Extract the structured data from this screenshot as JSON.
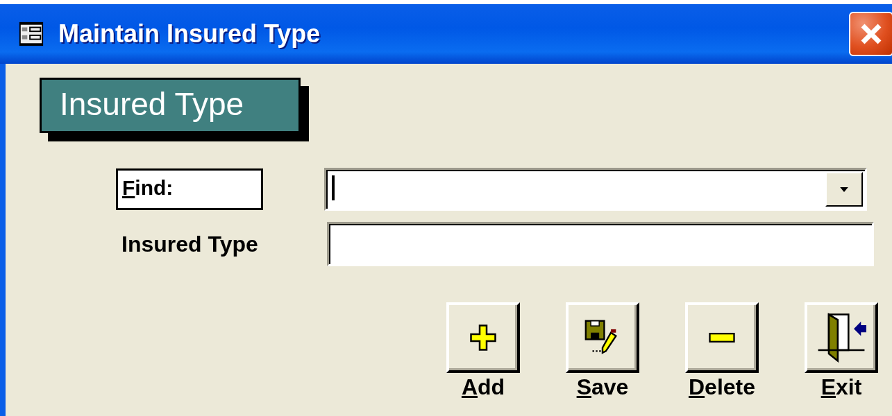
{
  "window": {
    "title": "Maintain Insured Type"
  },
  "heading": "Insured Type",
  "find": {
    "label": "Find:",
    "mnemonic_underlined": true
  },
  "insured_type": {
    "label": "Insured Type"
  },
  "buttons": [
    {
      "kind": "add",
      "label": "Add",
      "mnemonic_underlined": true
    },
    {
      "kind": "save",
      "label": "Save",
      "mnemonic_underlined": true
    },
    {
      "kind": "delete",
      "label": "Delete",
      "mnemonic_underlined": true
    },
    {
      "kind": "exit",
      "label": "Exit",
      "mnemonic_underlined": true
    }
  ]
}
